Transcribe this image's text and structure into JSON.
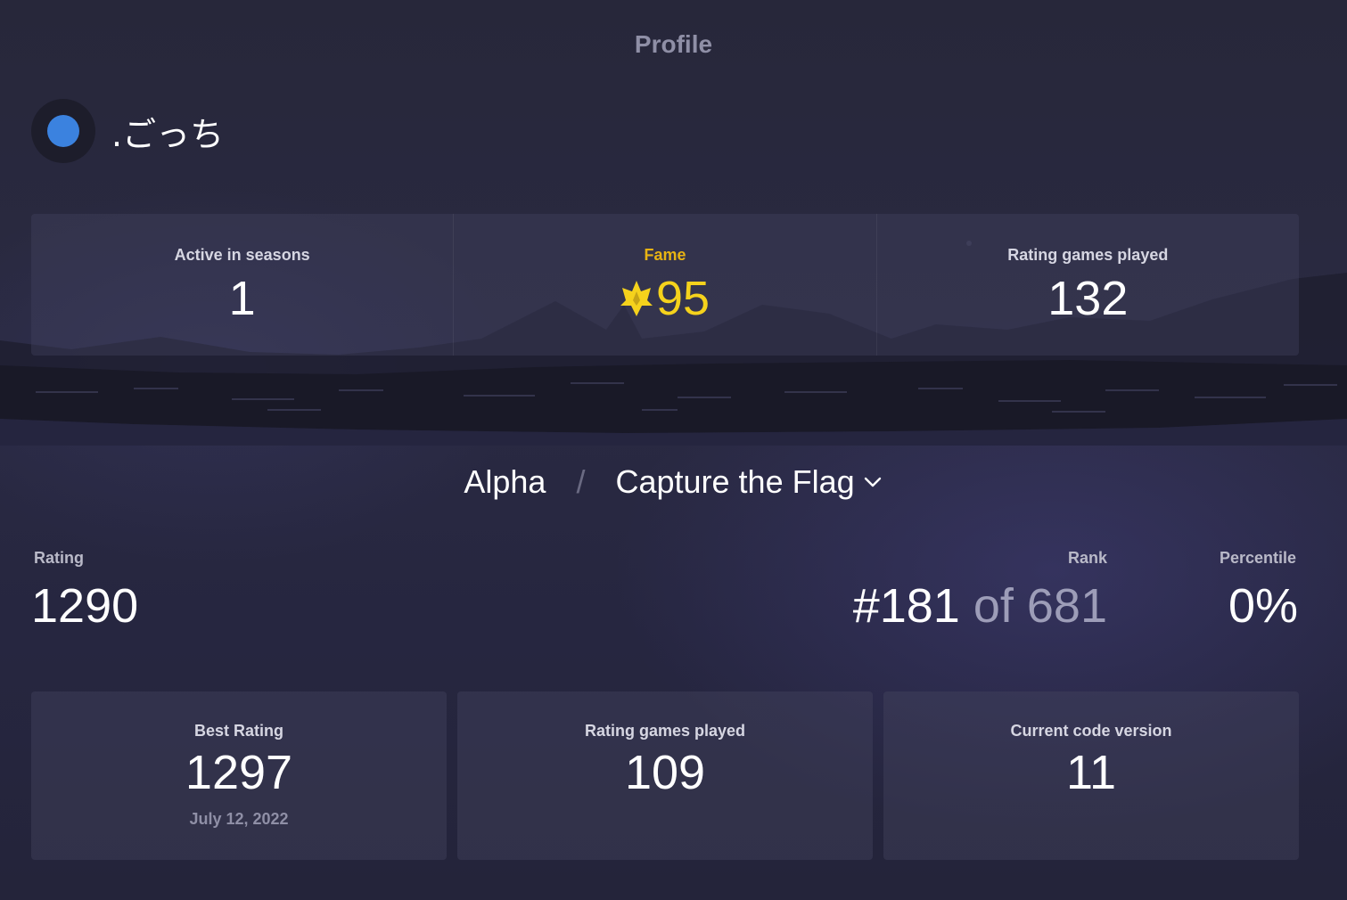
{
  "header": {
    "title": "Profile"
  },
  "player": {
    "name": ".ごっち",
    "avatar_color": "#3b82df"
  },
  "summary": {
    "active_seasons": {
      "label": "Active in seasons",
      "value": "1"
    },
    "fame": {
      "label": "Fame",
      "value": "95",
      "icon": "crown-icon",
      "color": "#f5d21c"
    },
    "rating_games": {
      "label": "Rating games played",
      "value": "132"
    }
  },
  "selector": {
    "season": "Alpha",
    "separator": "/",
    "mode": "Capture the Flag",
    "icon": "chevron-down-icon"
  },
  "stats": {
    "rating": {
      "label": "Rating",
      "value": "1290"
    },
    "rank": {
      "label": "Rank",
      "value": "#181",
      "of_text": "of 681"
    },
    "percentile": {
      "label": "Percentile",
      "value": "0%"
    }
  },
  "cards": {
    "best_rating": {
      "label": "Best Rating",
      "value": "1297",
      "date": "July 12, 2022"
    },
    "rating_games": {
      "label": "Rating games played",
      "value": "109"
    },
    "code_version": {
      "label": "Current code version",
      "value": "11"
    }
  }
}
